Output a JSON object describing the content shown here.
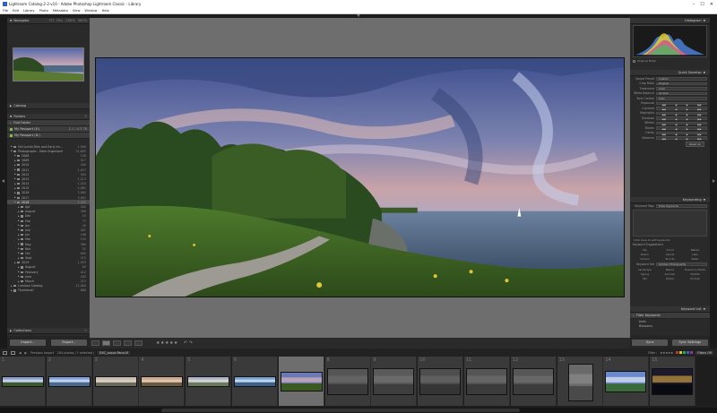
{
  "titlebar": {
    "title": "Lightroom Catalog-2-2-v10 - Adobe Photoshop Lightroom Classic - Library",
    "minimize": "–",
    "maximize": "☐",
    "close": "✕"
  },
  "menu": [
    "File",
    "Edit",
    "Library",
    "Photo",
    "Metadata",
    "View",
    "Window",
    "Help"
  ],
  "left_panel": {
    "navigator": "Navigator",
    "navigator_zoom": [
      "FIT",
      "FILL",
      "100%",
      "300%"
    ],
    "catalog": "Catalog",
    "folders": "Folders",
    "find_folder": "Find Folder",
    "volume_name": "My Passport (E:)",
    "volume_info": "2.1 / 4.5 TB",
    "volume2_name": "My Passport (D:)",
    "folder_rows": [
      {
        "name": "Old Lumia Files and Early Im...",
        "count": "1,900"
      },
      {
        "name": "Photographs - Date Organized",
        "count": "21,645"
      },
      {
        "name": "2008",
        "count": "126"
      },
      {
        "name": "2009",
        "count": "317"
      },
      {
        "name": "2010",
        "count": "440"
      },
      {
        "name": "2011",
        "count": "1,057"
      },
      {
        "name": "2012",
        "count": "904"
      },
      {
        "name": "2013",
        "count": "1,213"
      },
      {
        "name": "2014",
        "count": "1,310"
      },
      {
        "name": "2015",
        "count": "2,081"
      },
      {
        "name": "2016",
        "count": "3,062"
      },
      {
        "name": "2017",
        "count": "3,003"
      },
      {
        "name": "2018",
        "count": "2,565"
      },
      {
        "name": "Apr",
        "count": "201"
      },
      {
        "name": "August",
        "count": "309"
      },
      {
        "name": "Dec",
        "count": "53"
      },
      {
        "name": "Feb",
        "count": "77"
      },
      {
        "name": "Jan",
        "count": "45"
      },
      {
        "name": "July",
        "count": "287"
      },
      {
        "name": "Jun",
        "count": "196"
      },
      {
        "name": "Mar",
        "count": "145"
      },
      {
        "name": "May",
        "count": "380"
      },
      {
        "name": "Nov",
        "count": "52"
      },
      {
        "name": "Oct",
        "count": "605"
      },
      {
        "name": "Sept",
        "count": "215"
      },
      {
        "name": "2019",
        "count": "1,553"
      },
      {
        "name": "August",
        "count": "63"
      },
      {
        "name": "February",
        "count": "412"
      },
      {
        "name": "June",
        "count": "163"
      },
      {
        "name": "March",
        "count": "213"
      },
      {
        "name": "Lumiase Catalog",
        "count": "12,000"
      },
      {
        "name": "Thumbnail",
        "count": "660"
      }
    ],
    "collections": "Collections",
    "import": "Import...",
    "export": "Export..."
  },
  "right_panel": {
    "histogram": "Histogram",
    "original_photo": "Original Photo",
    "quick_develop": "Quick Develop",
    "saved_preset_label": "Saved Preset",
    "saved_preset_value": "Custom",
    "crop_ratio_label": "Crop Ratio",
    "crop_ratio_value": "Original",
    "treatment_label": "Treatment",
    "treatment_value": "Color",
    "white_balance_label": "White Balance",
    "white_balance_value": "As Shot",
    "tone_control_label": "Tone Control",
    "tone_control_value": "Auto",
    "adjustments": [
      "Exposure",
      "Contrast",
      "Highlights",
      "Shadows",
      "Whites",
      "Blacks",
      "Clarity",
      "Vibrance"
    ],
    "reset_all": "Reset All",
    "keywording": "Keywording",
    "keyword_tags_label": "Keyword Tags",
    "keyword_tags_value": "Enter Keywords",
    "click_to_add": "Click here to add keywords",
    "keyword_suggestions": "Keyword Suggestions",
    "suggestions": [
      "Sky",
      "Cloud",
      "Nature",
      "Beach",
      "Clouds",
      "Lake",
      "Ontario",
      "Toronto",
      "Water"
    ],
    "keyword_set_label": "Keyword Set",
    "keyword_set_value": "Outdoor Photography",
    "keyword_set_items": [
      "Landscape",
      "Nature",
      "Flowers & Plants",
      "Spring",
      "Summer",
      "Wildlife",
      "Fall",
      "Winter",
      "Portrait"
    ],
    "keyword_list": "Keyword List",
    "filter_keywords": "Filter Keywords",
    "keyword_list_items": [
      "birds",
      "Blossoms"
    ],
    "sync": "Sync",
    "sync_settings": "Sync Settings"
  },
  "filmbar": {
    "source": "Previous Import",
    "info": "204 photos / 1 selected /",
    "filename": "DSC_xxxxx-Pano.tif",
    "filter_label": "Filter :",
    "filter_value": "Filters Off",
    "colors": [
      "#c33",
      "#cc3",
      "#3a3",
      "#36c",
      "#939"
    ]
  },
  "filmstrip": {
    "numbers": [
      "1",
      "2",
      "3",
      "4",
      "5",
      "6",
      "7",
      "8",
      "9",
      "10",
      "11",
      "12",
      "13",
      "14",
      "15"
    ]
  },
  "toolbar": {
    "stars": "★★★★★",
    "rotate": "↶ ↷"
  }
}
